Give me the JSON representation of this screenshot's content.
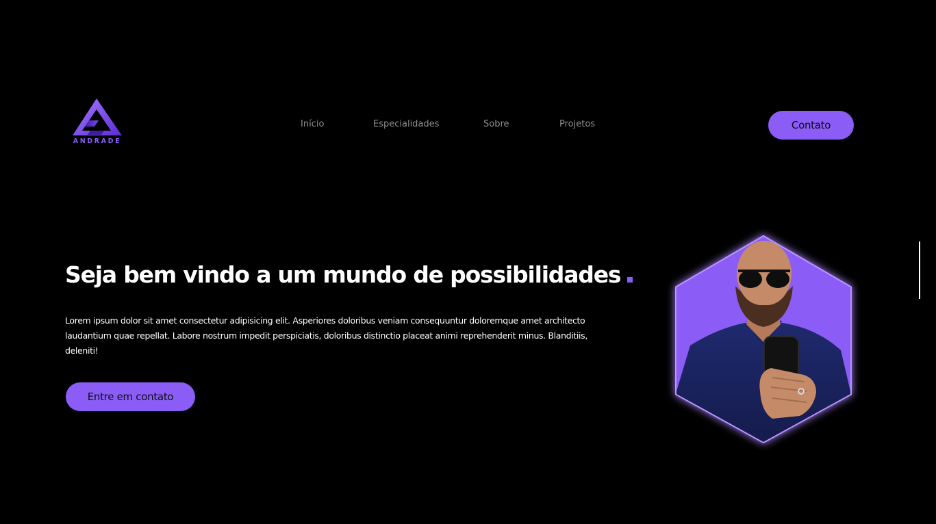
{
  "logo": {
    "text": "ANDRADE",
    "icon": "triangle-a-logo",
    "color": "#8b5cf6"
  },
  "nav": {
    "items": [
      {
        "label": "Início"
      },
      {
        "label": "Especialidades"
      },
      {
        "label": "Sobre"
      },
      {
        "label": "Projetos"
      }
    ]
  },
  "header": {
    "contact_label": "Contato"
  },
  "hero": {
    "title": "Seja bem vindo a um mundo de possibilidades",
    "description": "Lorem ipsum dolor sit amet consectetur adipisicing elit. Asperiores doloribus veniam consequuntur doloremque amet architecto laudantium quae repellat. Labore nostrum impedit perspiciatis, doloribus distinctio placeat animi reprehenderit minus. Blanditiis, deleniti!",
    "cta_label": "Entre em contato"
  },
  "portrait": {
    "shape": "hexagon",
    "subject": "man-with-sunglasses-selfie"
  },
  "colors": {
    "accent": "#8b5cf6",
    "background": "#000000",
    "text": "#ffffff",
    "nav_text": "#8f8f8f"
  }
}
